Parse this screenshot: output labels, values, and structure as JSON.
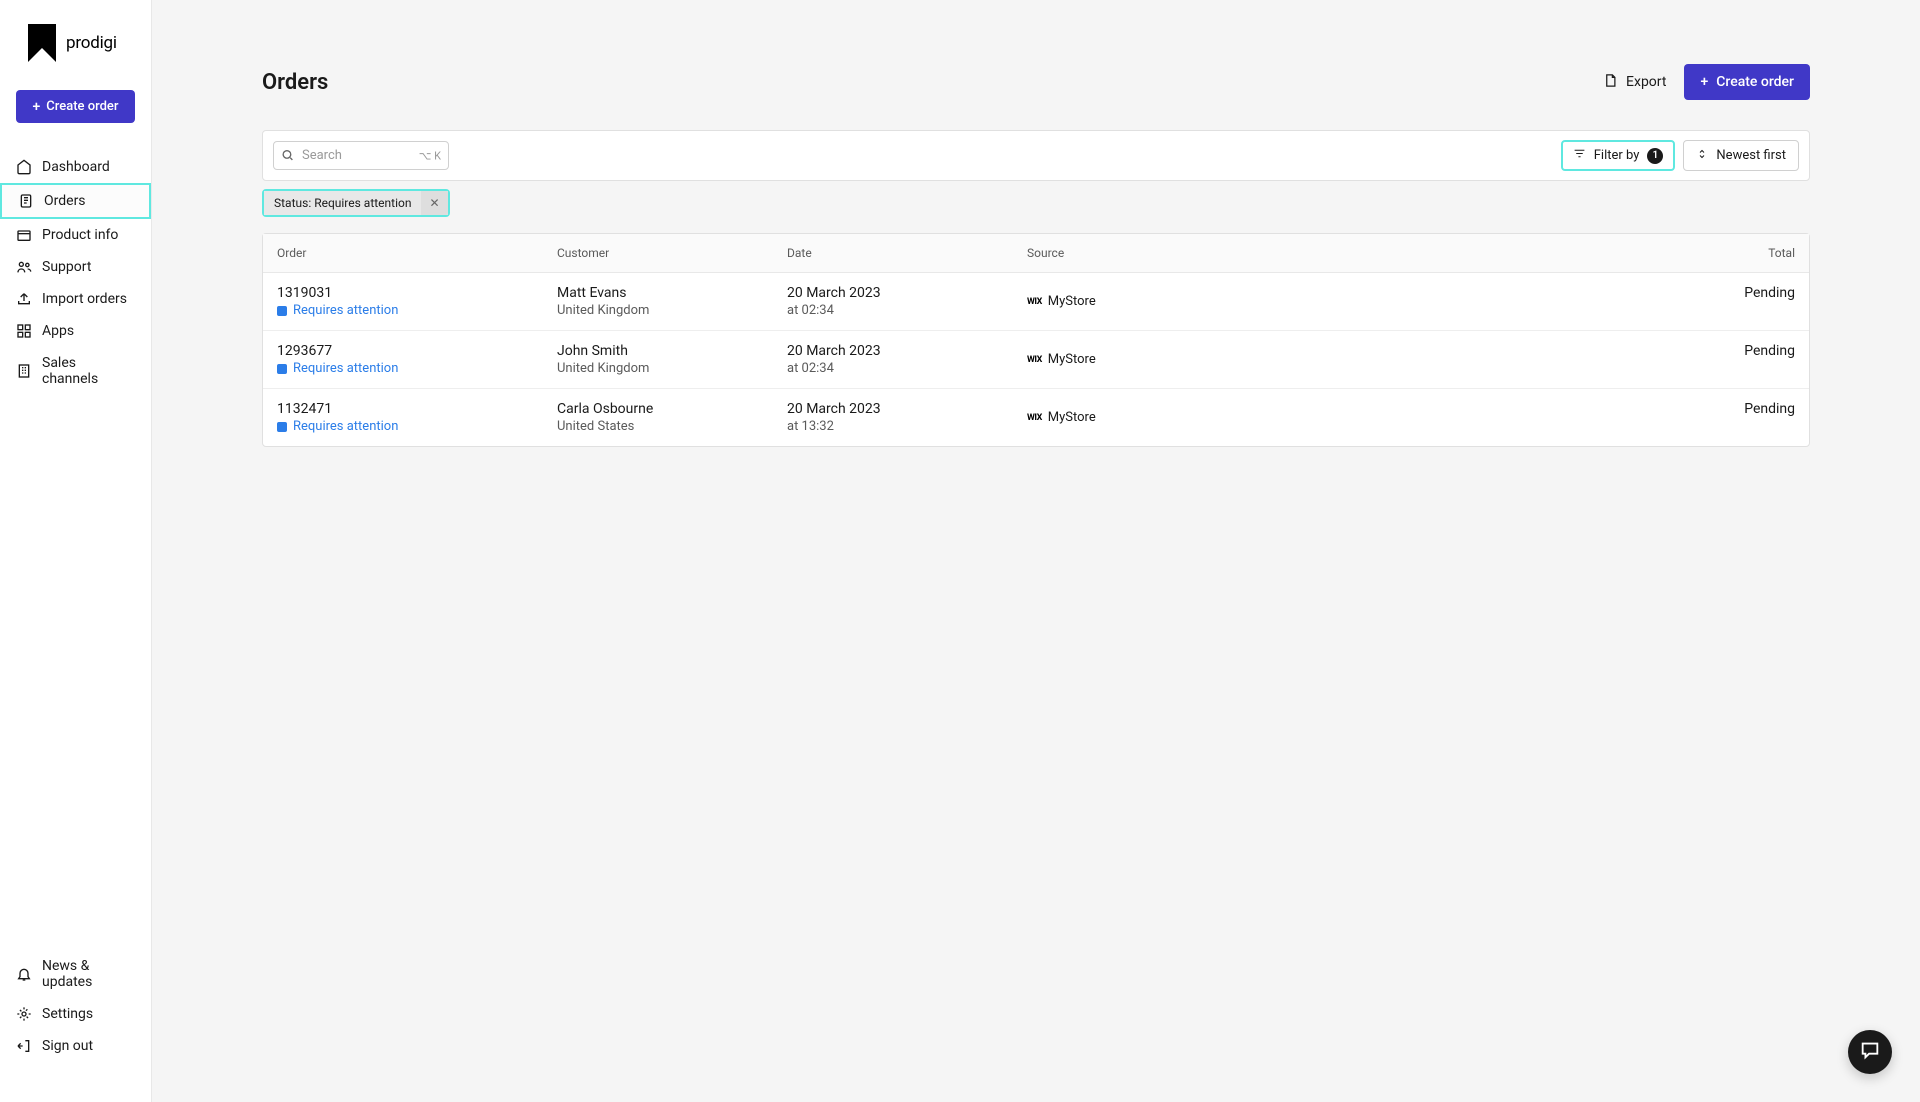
{
  "logo": {
    "text": "prodigi"
  },
  "sidebar": {
    "create_order_label": "Create order",
    "items": [
      {
        "label": "Dashboard",
        "icon": "home"
      },
      {
        "label": "Orders",
        "icon": "clipboard",
        "active": true
      },
      {
        "label": "Product info",
        "icon": "box"
      },
      {
        "label": "Support",
        "icon": "users"
      },
      {
        "label": "Import orders",
        "icon": "upload"
      },
      {
        "label": "Apps",
        "icon": "grid"
      },
      {
        "label": "Sales channels",
        "icon": "building"
      }
    ],
    "bottom_items": [
      {
        "label": "News & updates",
        "icon": "bell"
      },
      {
        "label": "Settings",
        "icon": "gear"
      },
      {
        "label": "Sign out",
        "icon": "signout"
      }
    ]
  },
  "header": {
    "title": "Orders",
    "export_label": "Export",
    "create_order_label": "Create order"
  },
  "toolbar": {
    "search_placeholder": "Search",
    "search_shortcut": "⌥ K",
    "filter_label": "Filter by",
    "filter_count": "1",
    "sort_label": "Newest first",
    "active_filter": "Status: Requires attention"
  },
  "table": {
    "headers": {
      "order": "Order",
      "customer": "Customer",
      "date": "Date",
      "source": "Source",
      "total": "Total"
    },
    "rows": [
      {
        "order_number": "1319031",
        "status_label": "Requires attention",
        "customer_name": "Matt Evans",
        "customer_country": "United Kingdom",
        "date": "20 March 2023",
        "time": "at 02:34",
        "source_logo": "WIX",
        "source_name": "MyStore",
        "total": "Pending"
      },
      {
        "order_number": "1293677",
        "status_label": "Requires attention",
        "customer_name": "John Smith",
        "customer_country": "United Kingdom",
        "date": "20 March 2023",
        "time": "at 02:34",
        "source_logo": "WIX",
        "source_name": "MyStore",
        "total": "Pending"
      },
      {
        "order_number": "1132471",
        "status_label": "Requires attention",
        "customer_name": "Carla Osbourne",
        "customer_country": "United States",
        "date": "20 March 2023",
        "time": "at 13:32",
        "source_logo": "WIX",
        "source_name": "MyStore",
        "total": "Pending"
      }
    ]
  }
}
